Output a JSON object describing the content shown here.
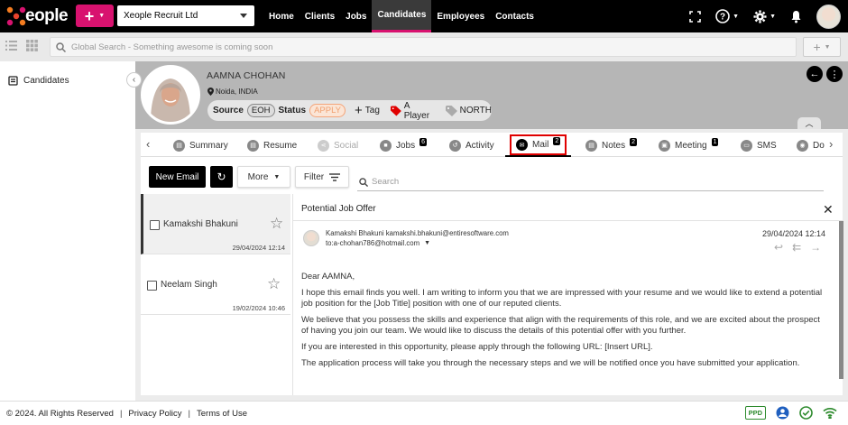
{
  "app": {
    "brand": "eople",
    "company": "Xeople Recruit Ltd"
  },
  "nav": {
    "items": [
      "Home",
      "Clients",
      "Jobs",
      "Candidates",
      "Employees",
      "Contacts"
    ],
    "active": "Candidates"
  },
  "search": {
    "placeholder": "Global Search - Something awesome is coming soon"
  },
  "sidebar": {
    "items": [
      {
        "label": "Candidates"
      }
    ]
  },
  "candidate": {
    "name": "AAMNA CHOHAN",
    "location": "Noida, INDIA",
    "source_label": "Source",
    "source_value": "EOH",
    "status_label": "Status",
    "status_value": "APPLY",
    "tag_label": "Tag",
    "rating_label": "A Player",
    "region_label": "NORTH"
  },
  "tabs": [
    {
      "label": "Summary"
    },
    {
      "label": "Resume"
    },
    {
      "label": "Social"
    },
    {
      "label": "Jobs",
      "badge": "6"
    },
    {
      "label": "Activity"
    },
    {
      "label": "Mail",
      "badge": "2"
    },
    {
      "label": "Notes",
      "badge": "2"
    },
    {
      "label": "Meeting",
      "badge": "1"
    },
    {
      "label": "SMS"
    },
    {
      "label": "Do"
    }
  ],
  "toolbar": {
    "new_email": "New Email",
    "more": "More",
    "filter": "Filter",
    "search_placeholder": "Search"
  },
  "mails": [
    {
      "name": "Kamakshi Bhakuni",
      "date": "29/04/2024 12:14"
    },
    {
      "name": "Neelam Singh",
      "date": "19/02/2024 10:46"
    }
  ],
  "email": {
    "subject": "Potential Job Offer",
    "from": "Kamakshi Bhakuni kamakshi.bhakuni@entiresoftware.com",
    "to": "to:a-chohan786@hotmail.com",
    "date": "29/04/2024 12:14",
    "greeting": "Dear AAMNA,",
    "p1": "I hope this email finds you well. I am writing to inform you that we are impressed with your resume and we would like to extend a potential job position for the [Job Title] position with one of our reputed clients.",
    "p2": "We believe that you possess the skills and experience that align with the requirements of this role, and we are excited about the prospect of having you join our team. We would like to discuss the details of this potential offer with you further.",
    "p3": "If you are interested in this opportunity, please apply through the following URL: [Insert URL].",
    "p4": "The application process will take you through the necessary steps and we will be notified once you have submitted your application."
  },
  "footer": {
    "copyright": "© 2024. All Rights Reserved",
    "privacy": "Privacy Policy",
    "terms": "Terms of Use",
    "ppd": "PPD"
  },
  "colors": {
    "accent": "#d8126f",
    "highlight": "#e00000",
    "topbar": "#000000"
  },
  "icons": [
    "x-logo-icon",
    "plus-icon",
    "fullscreen-icon",
    "help-icon",
    "gear-icon",
    "bell-icon",
    "list-view-icon",
    "grid-view-icon",
    "search-icon",
    "clipboard-icon",
    "pin-icon",
    "tag-icon",
    "refresh-icon",
    "filter-icon",
    "star-icon",
    "reply-icon",
    "reply-all-icon",
    "forward-icon",
    "close-icon",
    "user-circle-icon",
    "check-circle-icon",
    "wifi-icon"
  ]
}
